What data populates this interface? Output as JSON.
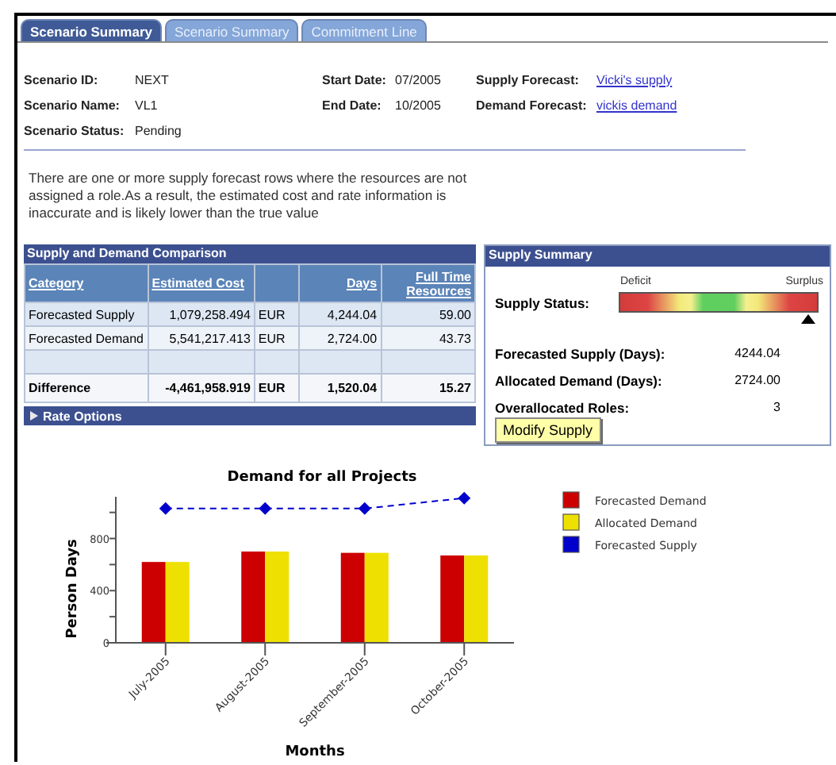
{
  "tabs": [
    {
      "label": "Scenario Summary",
      "selected": true
    },
    {
      "label": "Scenario Summary",
      "selected": false
    },
    {
      "label": "Commitment Line",
      "selected": false
    }
  ],
  "fields": [
    [
      {
        "label": "Scenario ID:",
        "value": "NEXT",
        "kind": "text"
      },
      {
        "label": "Start Date:",
        "value": "07/2005",
        "kind": "text"
      },
      {
        "label": "Supply Forecast:",
        "value": "Vicki's supply",
        "kind": "link"
      }
    ],
    [
      {
        "label": "Scenario Name:",
        "value": "VL1",
        "kind": "text"
      },
      {
        "label": "End Date:",
        "value": "10/2005",
        "kind": "text"
      },
      {
        "label": "Demand Forecast:",
        "value": "vickis demand",
        "kind": "link"
      }
    ],
    [
      {
        "label": "Scenario Status:",
        "value": "Pending",
        "kind": "text"
      }
    ]
  ],
  "message": "There are one or more supply forecast rows where the resources are not assigned a role.As a result, the estimated cost and rate information is inaccurate and is likely lower than the true value",
  "comparison": {
    "title": "Supply and Demand Comparison",
    "columns": [
      {
        "kind": "link",
        "label": "Category"
      },
      {
        "kind": "link",
        "label": "Estimated Cost"
      },
      {
        "kind": "blank"
      },
      {
        "kind": "link",
        "label": "Days"
      },
      {
        "kind": "link",
        "label": "Full Time Resources"
      }
    ],
    "rows": [
      {
        "kind": "data",
        "cells": [
          "Forecasted Supply",
          "1,079,258.494",
          "EUR",
          "4,244.04",
          "59.00"
        ]
      },
      {
        "kind": "data",
        "cells": [
          "Forecasted Demand",
          "5,541,217.413",
          "EUR",
          "2,724.00",
          "43.73"
        ]
      },
      {
        "kind": "blank"
      },
      {
        "kind": "total",
        "cells": [
          "Difference",
          "-4,461,958.919",
          "EUR",
          "1,520.04",
          "15.27"
        ]
      }
    ],
    "section": {
      "label": "Rate Options",
      "expanded": false
    }
  },
  "supply_summary": {
    "title": "Supply Summary",
    "status_label": "Supply Status:",
    "low_label": "Deficit",
    "high_label": "Surplus",
    "level": 0.96,
    "stats": [
      {
        "label": "Forecasted Supply (Days):",
        "value": "4244.04"
      },
      {
        "label": "Allocated Demand (Days):",
        "value": "2724.00"
      },
      {
        "label": "Overallocated Roles:",
        "value": "3"
      }
    ],
    "button": "Modify Supply"
  },
  "chart": {
    "chart_data": {
      "type": "bar",
      "title": "Demand for all Projects",
      "xlabel": "Months",
      "ylabel": "Person Days",
      "categories": [
        "July-2005",
        "August-2005",
        "September-2005",
        "October-2005"
      ],
      "series": [
        {
          "name": "Forecasted Demand",
          "color": "#cc0000",
          "type": "bar",
          "values": [
            620,
            700,
            690,
            670
          ]
        },
        {
          "name": "Allocated Demand",
          "color": "#eee000",
          "type": "bar",
          "values": [
            620,
            700,
            690,
            670
          ]
        },
        {
          "name": "Forecasted Supply",
          "color": "#0000cc",
          "type": "line",
          "line_style": "dashed",
          "marker": "diamond",
          "values": [
            1030,
            1030,
            1030,
            1110
          ]
        }
      ],
      "ylim": [
        0,
        1120
      ],
      "yticks": [
        0,
        400,
        800
      ],
      "legend": true
    }
  }
}
